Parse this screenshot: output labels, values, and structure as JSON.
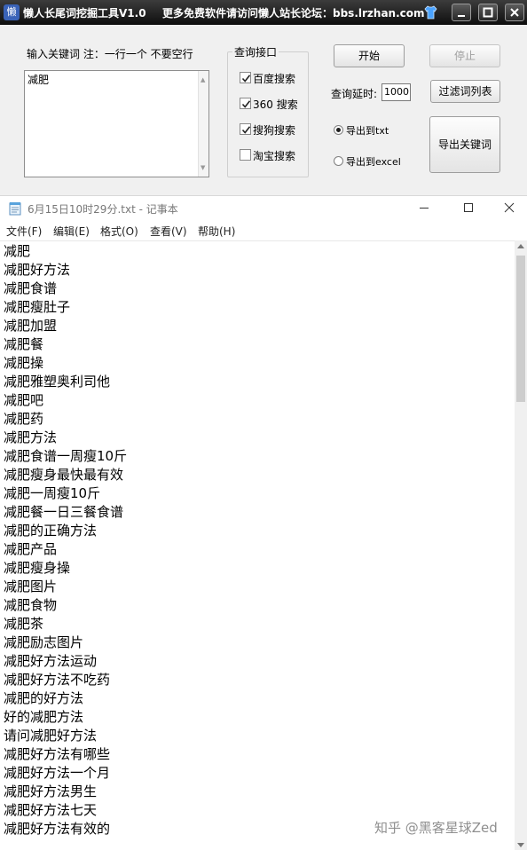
{
  "tool": {
    "app_icon_glyph": "懒",
    "title": "懒人长尾词挖掘工具V1.0",
    "notice": "更多免费软件请访问懒人站长论坛：bbs.lrzhan.com",
    "keyword_hint": "输入关键词  注：一行一个 不要空行",
    "keyword_value": "减肥",
    "engine_group_title": "查询接口",
    "engines": [
      {
        "label": "百度搜索",
        "checked": true
      },
      {
        "label": "360 搜索",
        "checked": true
      },
      {
        "label": "搜狗搜索",
        "checked": true
      },
      {
        "label": "淘宝搜索",
        "checked": false
      }
    ],
    "start_label": "开始",
    "stop_label": "停止",
    "delay_label": "查询延时:",
    "delay_value": "1000",
    "filter_label": "过滤词列表",
    "export_options": [
      {
        "label": "导出到txt",
        "selected": true
      },
      {
        "label": "导出到excel",
        "selected": false
      }
    ],
    "export_button_label": "导出关键词"
  },
  "notepad": {
    "title": "6月15日10时29分.txt - 记事本",
    "menus": [
      "文件(F)",
      "编辑(E)",
      "格式(O)",
      "查看(V)",
      "帮助(H)"
    ],
    "lines": [
      "减肥",
      "减肥好方法",
      "减肥食谱",
      "减肥瘦肚子",
      "减肥加盟",
      "减肥餐",
      "减肥操",
      "减肥雅塑奥利司他",
      "减肥吧",
      "减肥药",
      "减肥方法",
      "减肥食谱一周瘦10斤",
      "减肥瘦身最快最有效",
      "减肥一周瘦10斤",
      "减肥餐一日三餐食谱",
      "减肥的正确方法",
      "减肥产品",
      "减肥瘦身操",
      "减肥图片",
      "减肥食物",
      "减肥茶",
      "减肥励志图片",
      "减肥好方法运动",
      "减肥好方法不吃药",
      "减肥的好方法",
      "好的减肥方法",
      "请问减肥好方法",
      "减肥好方法有哪些",
      "减肥好方法一个月",
      "减肥好方法男生",
      "减肥好方法七天",
      "减肥好方法有效的"
    ]
  },
  "watermark": "知乎 @黑客星球Zed"
}
